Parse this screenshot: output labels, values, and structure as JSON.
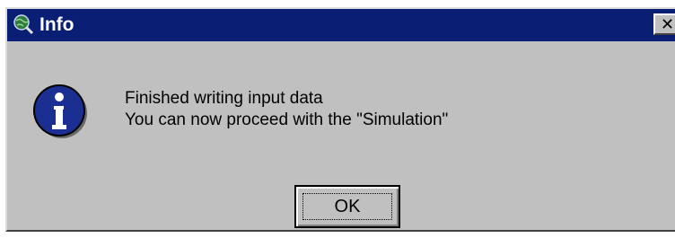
{
  "window": {
    "title": "Info",
    "title_icon": "globe-magnifier-icon",
    "close_glyph": "✕"
  },
  "message": {
    "icon": "info-icon",
    "line1": "Finished writing input data",
    "line2": "You can now proceed with the \"Simulation\""
  },
  "buttons": {
    "ok_label": "OK"
  },
  "colors": {
    "titlebar": "#0a1f73",
    "dialog_bg": "#c0c0c0",
    "info_icon_blue": "#1b2f93"
  }
}
